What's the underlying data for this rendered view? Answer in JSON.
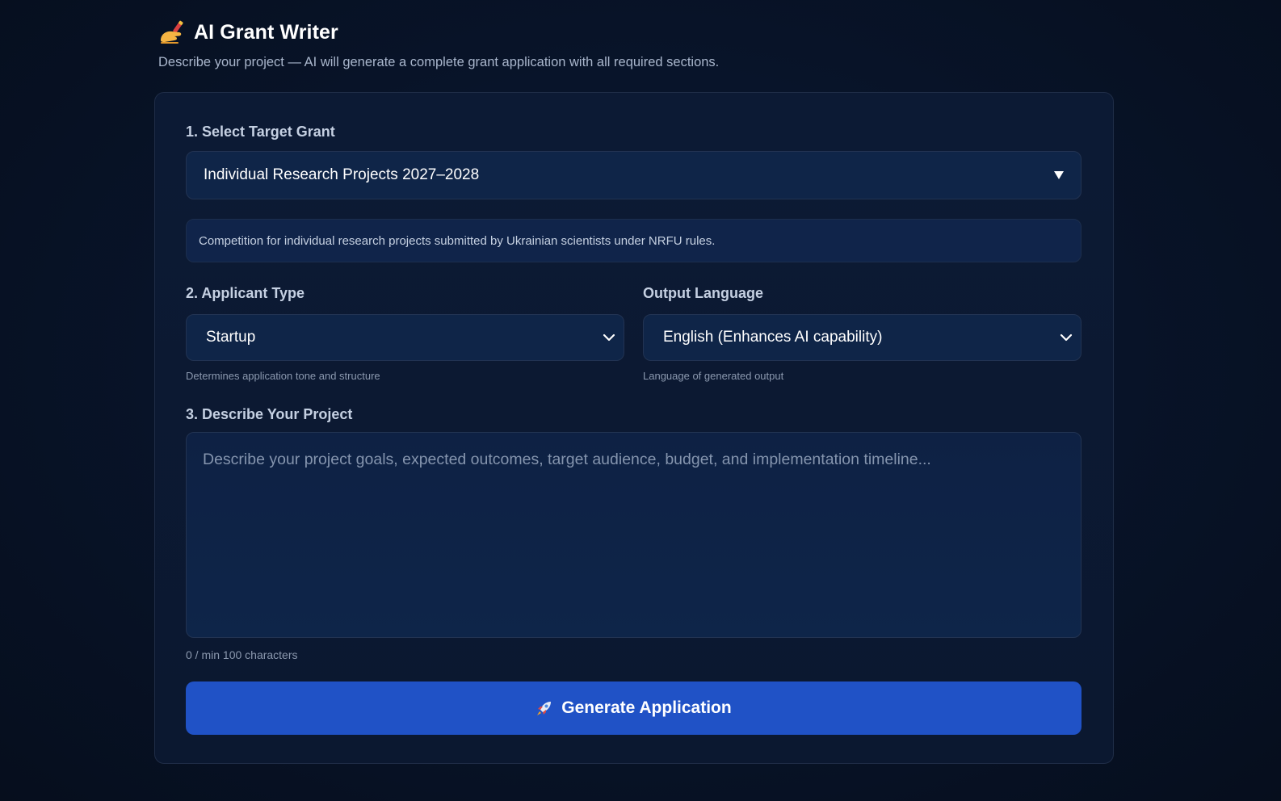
{
  "header": {
    "icon": "writing-hand-icon",
    "title": "AI Grant Writer",
    "subtitle": "Describe your project — AI will generate a complete grant application with all required sections."
  },
  "grant": {
    "label": "1. Select Target Grant",
    "selected": "Individual Research Projects 2027–2028",
    "description": "Competition for individual research projects submitted by Ukrainian scientists under NRFU rules."
  },
  "applicant": {
    "label": "2. Applicant Type",
    "selected": "Startup",
    "hint": "Determines application tone and structure"
  },
  "language": {
    "label": "Output Language",
    "selected": "English (Enhances AI capability)",
    "hint": "Language of generated output"
  },
  "project": {
    "label": "3. Describe Your Project",
    "placeholder": "Describe your project goals, expected outcomes, target audience, budget, and implementation timeline...",
    "value": "",
    "counter": "0 / min 100 characters"
  },
  "actions": {
    "generate_label": "Generate Application",
    "generate_icon": "rocket-icon"
  },
  "colors": {
    "background": "#08142a",
    "card": "#0c1a34",
    "input": "#0f2548",
    "accent": "#2052c6"
  }
}
